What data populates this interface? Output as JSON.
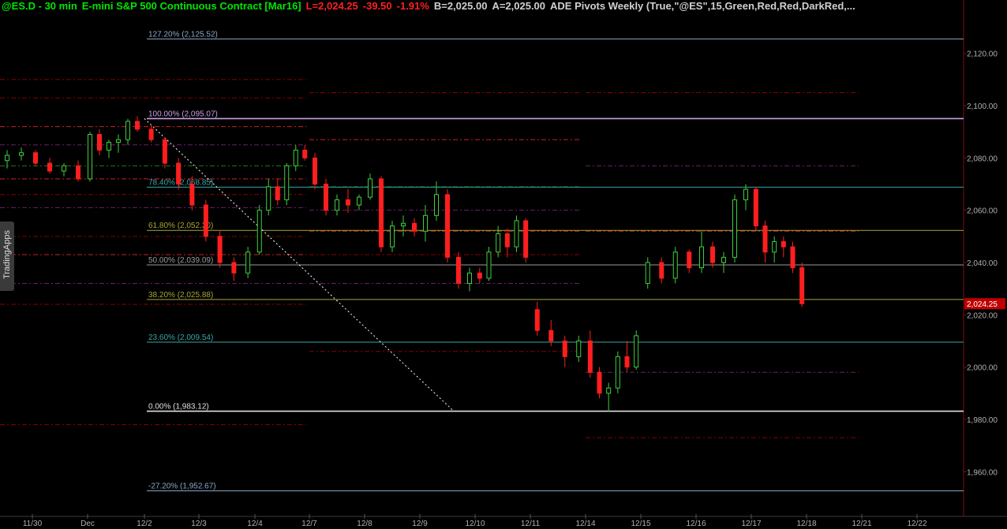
{
  "header": {
    "symbol": "@ES.D - 30 min",
    "description": "E-mini S&P 500 Continuous Contract [Mar16]",
    "last": "L=2,024.25",
    "change": "-39.50",
    "change_pct": "-1.91%",
    "bid": "B=2,025.00",
    "ask": "A=2,025.00",
    "indicator": "ADE Pivots Weekly (True,\"@ES\",15,Green,Red,Red,DarkRed,...",
    "colors": {
      "symbol": "#00e600",
      "quote": "#ff2020",
      "neutral": "#d0d0d0"
    }
  },
  "side_tab": {
    "label": "TradingApps"
  },
  "chart_data": {
    "type": "candlestick",
    "symbol": "@ES.D",
    "interval": "30 min",
    "ylim": [
      1945,
      2135
    ],
    "y_ticks": [
      "1,960.00",
      "1,980.00",
      "2,000.00",
      "2,020.00",
      "2,040.00",
      "2,060.00",
      "2,080.00",
      "2,100.00",
      "2,120.00"
    ],
    "y_tick_values": [
      1960,
      1980,
      2000,
      2020,
      2040,
      2060,
      2080,
      2100,
      2120
    ],
    "x_labels": [
      "11/30",
      "Dec",
      "12/2",
      "12/3",
      "12/4",
      "12/7",
      "12/8",
      "12/9",
      "12/10",
      "12/11",
      "12/14",
      "12/15",
      "12/16",
      "12/17",
      "12/18",
      "12/21",
      "12/22"
    ],
    "last_price": {
      "value": 2024.25,
      "label": "2,024.25"
    },
    "fib_levels": [
      {
        "label": "127.20% (2,125.52)",
        "value": 2125.52,
        "color": "#8aa8c8"
      },
      {
        "label": "100.00% (2,095.07)",
        "value": 2095.07,
        "color": "#c9a0e6"
      },
      {
        "label": "78.40% (2,068.85)",
        "value": 2068.85,
        "color": "#3aa6a6"
      },
      {
        "label": "61.80% (2,052.30)",
        "value": 2052.3,
        "color": "#a9a53a"
      },
      {
        "label": "50.00% (2,039.09)",
        "value": 2039.09,
        "color": "#9a9a9a"
      },
      {
        "label": "38.20% (2,025.88)",
        "value": 2025.88,
        "color": "#a9a53a"
      },
      {
        "label": "23.60% (2,009.54)",
        "value": 2009.54,
        "color": "#3aa6a6"
      },
      {
        "label": "0.00% (1,983.12)",
        "value": 1983.12,
        "color": "#e0e0e0"
      },
      {
        "label": "-27.20% (1,952.67)",
        "value": 1952.67,
        "color": "#8aa8c8"
      }
    ],
    "pivot_weeks": [
      {
        "week": "11/30",
        "levels": [
          {
            "value": 2110,
            "color": "#8b0000"
          },
          {
            "value": 2103,
            "color": "#8b0000"
          },
          {
            "value": 2092,
            "color": "#cc2020"
          },
          {
            "value": 2085,
            "color": "#6b1f6b"
          },
          {
            "value": 2077,
            "color": "#1f7a1f"
          },
          {
            "value": 2072,
            "color": "#cc2020"
          },
          {
            "value": 2066,
            "color": "#8b0000"
          },
          {
            "value": 2061,
            "color": "#6b1f6b"
          },
          {
            "value": 2050,
            "color": "#8b0000"
          },
          {
            "value": 2043,
            "color": "#cc2020"
          },
          {
            "value": 2032,
            "color": "#6b1f6b"
          },
          {
            "value": 2024,
            "color": "#8b0000"
          },
          {
            "value": 1978,
            "color": "#8b0000"
          }
        ]
      },
      {
        "week": "12/7",
        "levels": [
          {
            "value": 2105,
            "color": "#8b0000"
          },
          {
            "value": 2087,
            "color": "#cc2020"
          },
          {
            "value": 2069,
            "color": "#1f7a1f"
          },
          {
            "value": 2060,
            "color": "#6b1f6b"
          },
          {
            "value": 2052,
            "color": "#cc2020"
          },
          {
            "value": 2043,
            "color": "#8b0000"
          },
          {
            "value": 2032,
            "color": "#6b1f6b"
          },
          {
            "value": 2006,
            "color": "#8b0000"
          }
        ]
      },
      {
        "week": "12/14",
        "levels": [
          {
            "value": 2105,
            "color": "#8b0000"
          },
          {
            "value": 2077,
            "color": "#6b1f6b"
          },
          {
            "value": 2052,
            "color": "#cc2020"
          },
          {
            "value": 1998,
            "color": "#6b1f6b"
          },
          {
            "value": 1973,
            "color": "#8b0000"
          }
        ]
      }
    ],
    "trend_line": {
      "from": {
        "time": "12/2",
        "price": 2095.07
      },
      "to": {
        "time": "12/9",
        "price": 1983.12
      }
    },
    "candles": [
      {
        "time": "11/30",
        "o": 2079,
        "h": 2083,
        "l": 2076,
        "c": 2081
      },
      {
        "time": "11/30",
        "o": 2081,
        "h": 2084,
        "l": 2079,
        "c": 2082
      },
      {
        "time": "11/30",
        "o": 2082,
        "h": 2083,
        "l": 2077,
        "c": 2078
      },
      {
        "time": "11/30",
        "o": 2078,
        "h": 2080,
        "l": 2074,
        "c": 2075
      },
      {
        "time": "11/30",
        "o": 2075,
        "h": 2078,
        "l": 2073,
        "c": 2077
      },
      {
        "time": "11/30",
        "o": 2077,
        "h": 2079,
        "l": 2071,
        "c": 2072
      },
      {
        "time": "Dec",
        "o": 2072,
        "h": 2090,
        "l": 2071,
        "c": 2089
      },
      {
        "time": "Dec",
        "o": 2089,
        "h": 2091,
        "l": 2081,
        "c": 2083
      },
      {
        "time": "Dec",
        "o": 2083,
        "h": 2087,
        "l": 2080,
        "c": 2086
      },
      {
        "time": "Dec",
        "o": 2086,
        "h": 2089,
        "l": 2082,
        "c": 2087
      },
      {
        "time": "Dec",
        "o": 2087,
        "h": 2095,
        "l": 2085,
        "c": 2094
      },
      {
        "time": "Dec",
        "o": 2094,
        "h": 2096,
        "l": 2090,
        "c": 2091
      },
      {
        "time": "12/2",
        "o": 2091,
        "h": 2093,
        "l": 2086,
        "c": 2087
      },
      {
        "time": "12/2",
        "o": 2087,
        "h": 2088,
        "l": 2076,
        "c": 2078
      },
      {
        "time": "12/2",
        "o": 2078,
        "h": 2080,
        "l": 2068,
        "c": 2070
      },
      {
        "time": "12/2",
        "o": 2070,
        "h": 2073,
        "l": 2060,
        "c": 2062
      },
      {
        "time": "12/3",
        "o": 2062,
        "h": 2064,
        "l": 2048,
        "c": 2050
      },
      {
        "time": "12/3",
        "o": 2050,
        "h": 2052,
        "l": 2038,
        "c": 2040
      },
      {
        "time": "12/3",
        "o": 2040,
        "h": 2042,
        "l": 2033,
        "c": 2036
      },
      {
        "time": "12/3",
        "o": 2036,
        "h": 2046,
        "l": 2034,
        "c": 2044
      },
      {
        "time": "12/4",
        "o": 2044,
        "h": 2062,
        "l": 2043,
        "c": 2060
      },
      {
        "time": "12/4",
        "o": 2060,
        "h": 2072,
        "l": 2058,
        "c": 2069
      },
      {
        "time": "12/4",
        "o": 2069,
        "h": 2072,
        "l": 2062,
        "c": 2064
      },
      {
        "time": "12/4",
        "o": 2064,
        "h": 2078,
        "l": 2062,
        "c": 2077
      },
      {
        "time": "12/4",
        "o": 2077,
        "h": 2085,
        "l": 2075,
        "c": 2083
      },
      {
        "time": "12/4",
        "o": 2083,
        "h": 2085,
        "l": 2079,
        "c": 2080
      },
      {
        "time": "12/7",
        "o": 2080,
        "h": 2082,
        "l": 2068,
        "c": 2070
      },
      {
        "time": "12/7",
        "o": 2070,
        "h": 2072,
        "l": 2058,
        "c": 2060
      },
      {
        "time": "12/7",
        "o": 2060,
        "h": 2066,
        "l": 2058,
        "c": 2064
      },
      {
        "time": "12/7",
        "o": 2064,
        "h": 2068,
        "l": 2059,
        "c": 2062
      },
      {
        "time": "12/7",
        "o": 2062,
        "h": 2066,
        "l": 2060,
        "c": 2065
      },
      {
        "time": "12/8",
        "o": 2065,
        "h": 2074,
        "l": 2064,
        "c": 2072
      },
      {
        "time": "12/8",
        "o": 2072,
        "h": 2073,
        "l": 2044,
        "c": 2046
      },
      {
        "time": "12/8",
        "o": 2046,
        "h": 2056,
        "l": 2044,
        "c": 2054
      },
      {
        "time": "12/8",
        "o": 2054,
        "h": 2058,
        "l": 2050,
        "c": 2055
      },
      {
        "time": "12/8",
        "o": 2055,
        "h": 2057,
        "l": 2050,
        "c": 2052
      },
      {
        "time": "12/9",
        "o": 2052,
        "h": 2062,
        "l": 2048,
        "c": 2058
      },
      {
        "time": "12/9",
        "o": 2058,
        "h": 2071,
        "l": 2056,
        "c": 2066
      },
      {
        "time": "12/9",
        "o": 2066,
        "h": 2068,
        "l": 2040,
        "c": 2042
      },
      {
        "time": "12/9",
        "o": 2042,
        "h": 2044,
        "l": 2030,
        "c": 2032
      },
      {
        "time": "12/9",
        "o": 2032,
        "h": 2038,
        "l": 2029,
        "c": 2036
      },
      {
        "time": "12/10",
        "o": 2036,
        "h": 2038,
        "l": 2032,
        "c": 2034
      },
      {
        "time": "12/10",
        "o": 2034,
        "h": 2046,
        "l": 2033,
        "c": 2044
      },
      {
        "time": "12/10",
        "o": 2044,
        "h": 2054,
        "l": 2042,
        "c": 2051
      },
      {
        "time": "12/10",
        "o": 2051,
        "h": 2053,
        "l": 2042,
        "c": 2046
      },
      {
        "time": "12/10",
        "o": 2046,
        "h": 2058,
        "l": 2044,
        "c": 2056
      },
      {
        "time": "12/10",
        "o": 2056,
        "h": 2057,
        "l": 2040,
        "c": 2042
      },
      {
        "time": "12/11",
        "o": 2022,
        "h": 2025,
        "l": 2012,
        "c": 2014
      },
      {
        "time": "12/11",
        "o": 2014,
        "h": 2018,
        "l": 2008,
        "c": 2010
      },
      {
        "time": "12/11",
        "o": 2010,
        "h": 2012,
        "l": 2000,
        "c": 2004
      },
      {
        "time": "12/11",
        "o": 2004,
        "h": 2012,
        "l": 2002,
        "c": 2010
      },
      {
        "time": "12/14",
        "o": 2010,
        "h": 2014,
        "l": 1996,
        "c": 1998
      },
      {
        "time": "12/14",
        "o": 1998,
        "h": 2000,
        "l": 1988,
        "c": 1990
      },
      {
        "time": "12/14",
        "o": 1990,
        "h": 1994,
        "l": 1983,
        "c": 1992
      },
      {
        "time": "12/14",
        "o": 1992,
        "h": 2006,
        "l": 1990,
        "c": 2004
      },
      {
        "time": "12/14",
        "o": 2004,
        "h": 2010,
        "l": 1998,
        "c": 2000
      },
      {
        "time": "12/14",
        "o": 2000,
        "h": 2014,
        "l": 1999,
        "c": 2012
      },
      {
        "time": "12/15",
        "o": 2032,
        "h": 2042,
        "l": 2030,
        "c": 2040
      },
      {
        "time": "12/15",
        "o": 2040,
        "h": 2042,
        "l": 2032,
        "c": 2034
      },
      {
        "time": "12/15",
        "o": 2034,
        "h": 2046,
        "l": 2032,
        "c": 2044
      },
      {
        "time": "12/15",
        "o": 2044,
        "h": 2045,
        "l": 2036,
        "c": 2038
      },
      {
        "time": "12/16",
        "o": 2038,
        "h": 2052,
        "l": 2036,
        "c": 2046
      },
      {
        "time": "12/16",
        "o": 2046,
        "h": 2048,
        "l": 2038,
        "c": 2040
      },
      {
        "time": "12/16",
        "o": 2040,
        "h": 2044,
        "l": 2036,
        "c": 2042
      },
      {
        "time": "12/16",
        "o": 2042,
        "h": 2066,
        "l": 2040,
        "c": 2064
      },
      {
        "time": "12/16",
        "o": 2064,
        "h": 2070,
        "l": 2060,
        "c": 2068
      },
      {
        "time": "12/17",
        "o": 2068,
        "h": 2069,
        "l": 2052,
        "c": 2054
      },
      {
        "time": "12/17",
        "o": 2054,
        "h": 2056,
        "l": 2040,
        "c": 2044
      },
      {
        "time": "12/17",
        "o": 2044,
        "h": 2050,
        "l": 2040,
        "c": 2048
      },
      {
        "time": "12/17",
        "o": 2048,
        "h": 2050,
        "l": 2042,
        "c": 2046
      },
      {
        "time": "12/17",
        "o": 2046,
        "h": 2048,
        "l": 2036,
        "c": 2038
      },
      {
        "time": "12/17",
        "o": 2038,
        "h": 2040,
        "l": 2023,
        "c": 2024.25
      }
    ]
  }
}
